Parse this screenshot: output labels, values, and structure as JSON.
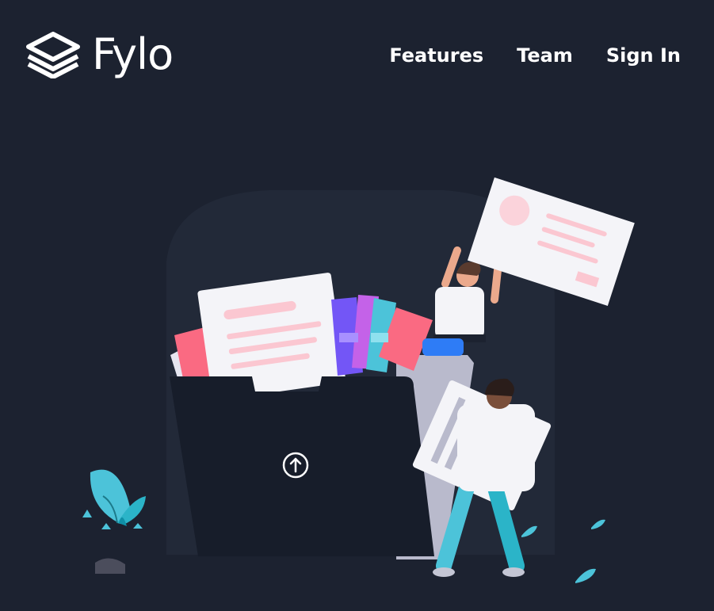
{
  "brand": {
    "name": "Fylo",
    "logo_icon": "stacked-layers-icon"
  },
  "nav": {
    "items": [
      {
        "label": "Features"
      },
      {
        "label": "Team"
      },
      {
        "label": "Sign In"
      }
    ]
  },
  "hero": {
    "illustration": "folder-with-documents-illustration",
    "upload_icon": "arrow-up-circle-icon"
  },
  "colors": {
    "background": "#1c2230",
    "folder": "#171d2a",
    "accent_teal": "#4cc3d9",
    "accent_pink": "#fa6a82",
    "text": "#ffffff"
  }
}
